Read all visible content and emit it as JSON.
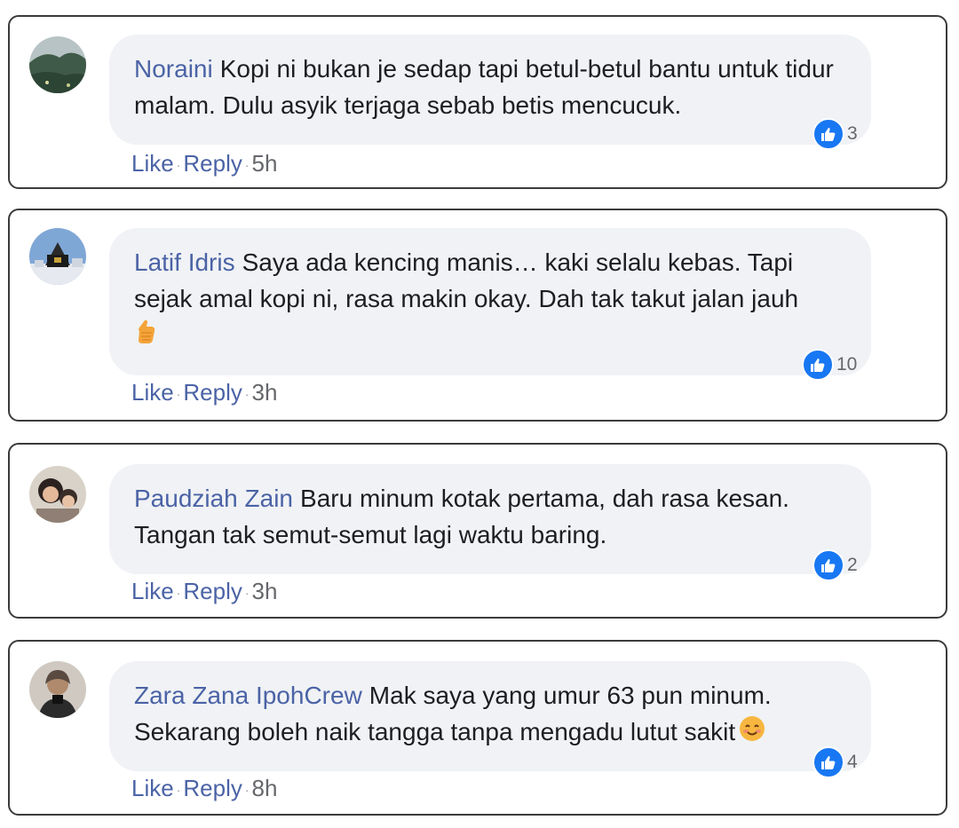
{
  "comments": [
    {
      "author": "Noraini",
      "text": "Kopi ni bukan je sedap tapi betul-betul bantu untuk tidur malam. Dulu asyik terjaga sebab betis mencucuk.",
      "reaction_count": "3",
      "like_label": "Like",
      "reply_label": "Reply",
      "time": "5h",
      "avatar": "avatar-landscape"
    },
    {
      "author": "Latif Idris",
      "text": "Saya ada kencing manis… kaki selalu kebas. Tapi sejak amal kopi ni, rasa makin okay. Dah tak takut jalan jauh",
      "emoji": "thumbs-up-emoji",
      "reaction_count": "10",
      "like_label": "Like",
      "reply_label": "Reply",
      "time": "3h",
      "avatar": "avatar-building"
    },
    {
      "author": "Paudziah Zain",
      "text": "Baru minum kotak pertama, dah rasa kesan. Tangan tak semut-semut lagi waktu baring.",
      "reaction_count": "2",
      "like_label": "Like",
      "reply_label": "Reply",
      "time": "3h",
      "avatar": "avatar-people"
    },
    {
      "author": "Zara Zana IpohCrew",
      "text": "Mak saya yang umur 63 pun minum. Sekarang boleh naik tangga tanpa mengadu lutut sakit",
      "emoji": "smiling-face-emoji",
      "reaction_count": "4",
      "like_label": "Like",
      "reply_label": "Reply",
      "time": "8h",
      "avatar": "avatar-person"
    }
  ],
  "colors": {
    "author_link": "#4b63a6",
    "bubble": "#f0f2f5",
    "like_blue": "#1877f2",
    "meta_gray": "#65676b"
  }
}
